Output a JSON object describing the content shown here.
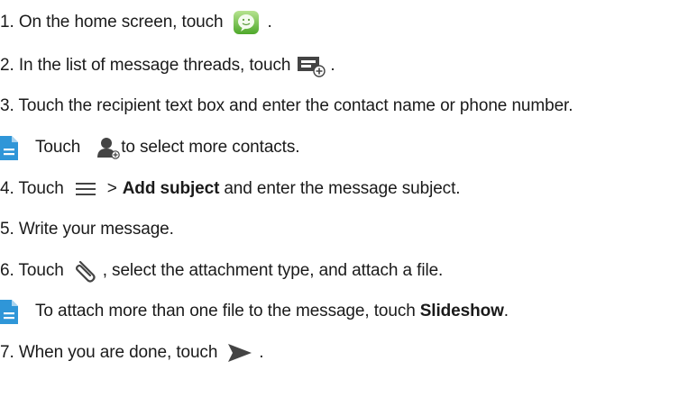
{
  "steps": {
    "step1": {
      "text": "1. On the home screen, touch",
      "icon": "messaging-app-icon",
      "end": "."
    },
    "step2": {
      "text": "2. In the list of message threads, touch",
      "icon": "new-message-icon",
      "end": "."
    },
    "step3": {
      "text": "3. Touch the recipient text box and enter the contact name or phone number."
    },
    "note1": {
      "icon": "note-icon",
      "pre": "Touch",
      "icon2": "add-contact-icon",
      "post": "to select more contacts."
    },
    "step4": {
      "pre": "4. Touch",
      "icon": "menu-icon",
      "gt": ">",
      "bold": "Add subject",
      "post": "and enter the message subject."
    },
    "step5": {
      "text": "5. Write your message."
    },
    "step6": {
      "pre": "6. Touch",
      "icon": "attachment-icon",
      "post": ", select the attachment type, and attach a file."
    },
    "note2": {
      "icon": "note-icon",
      "pre": "To attach more than one file to the message, touch",
      "bold": "Slideshow",
      "end": "."
    },
    "step7": {
      "pre": "7. When you are done, touch",
      "icon": "send-icon",
      "end": "."
    }
  },
  "colors": {
    "text": "#1a1a1a",
    "note_icon": "#2f96d8",
    "messaging_icon": "#6dbf4a",
    "dark_icon": "#444444"
  }
}
